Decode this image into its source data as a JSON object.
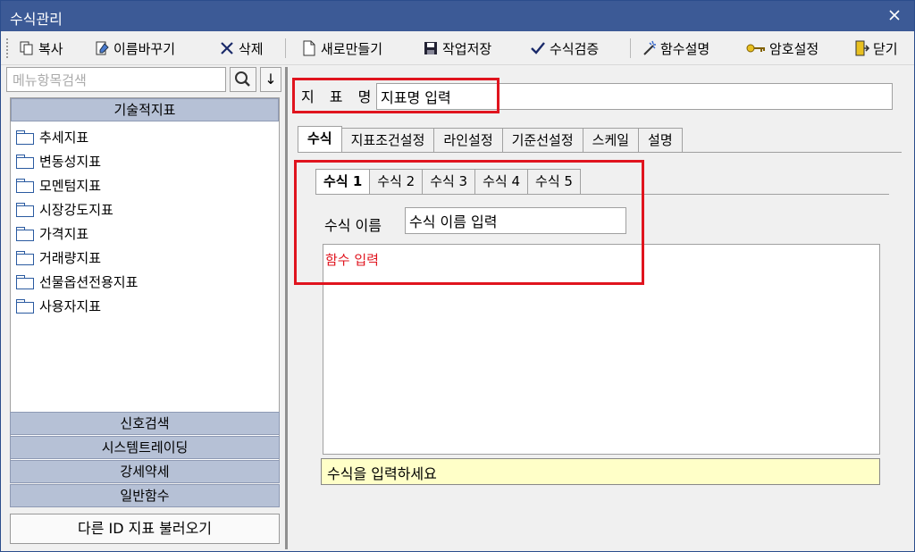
{
  "window": {
    "title": "수식관리"
  },
  "toolbar": {
    "copy": "복사",
    "rename": "이름바꾸기",
    "delete": "삭제",
    "new": "새로만들기",
    "save": "작업저장",
    "verify": "수식검증",
    "func_desc": "함수설명",
    "password": "암호설정",
    "close": "닫기"
  },
  "sidebar": {
    "search_placeholder": "메뉴항목검색",
    "group_title": "기술적지표",
    "items": [
      "추세지표",
      "변동성지표",
      "모멘텀지표",
      "시장강도지표",
      "가격지표",
      "거래량지표",
      "선물옵션전용지표",
      "사용자지표"
    ],
    "lower_groups": [
      "신호검색",
      "시스템트레이딩",
      "강세약세",
      "일반함수"
    ],
    "load_button": "다른 ID 지표 불러오기"
  },
  "main": {
    "name_label": "지 표 명",
    "name_value": "지표명 입력",
    "tabs": [
      "수식",
      "지표조건설정",
      "라인설정",
      "기준선설정",
      "스케일",
      "설명"
    ],
    "subtabs": [
      "수식 1",
      "수식 2",
      "수식 3",
      "수식 4",
      "수식 5"
    ],
    "formula_name_label": "수식 이름",
    "formula_name_value": "수식 이름 입력",
    "function_text": "함수 입력",
    "hint": "수식을 입력하세요"
  },
  "colors": {
    "titlebar": "#3c5a96",
    "highlight": "#e0141e",
    "hint_bg": "#ffffc8",
    "group_bg": "#b6c1d6"
  }
}
